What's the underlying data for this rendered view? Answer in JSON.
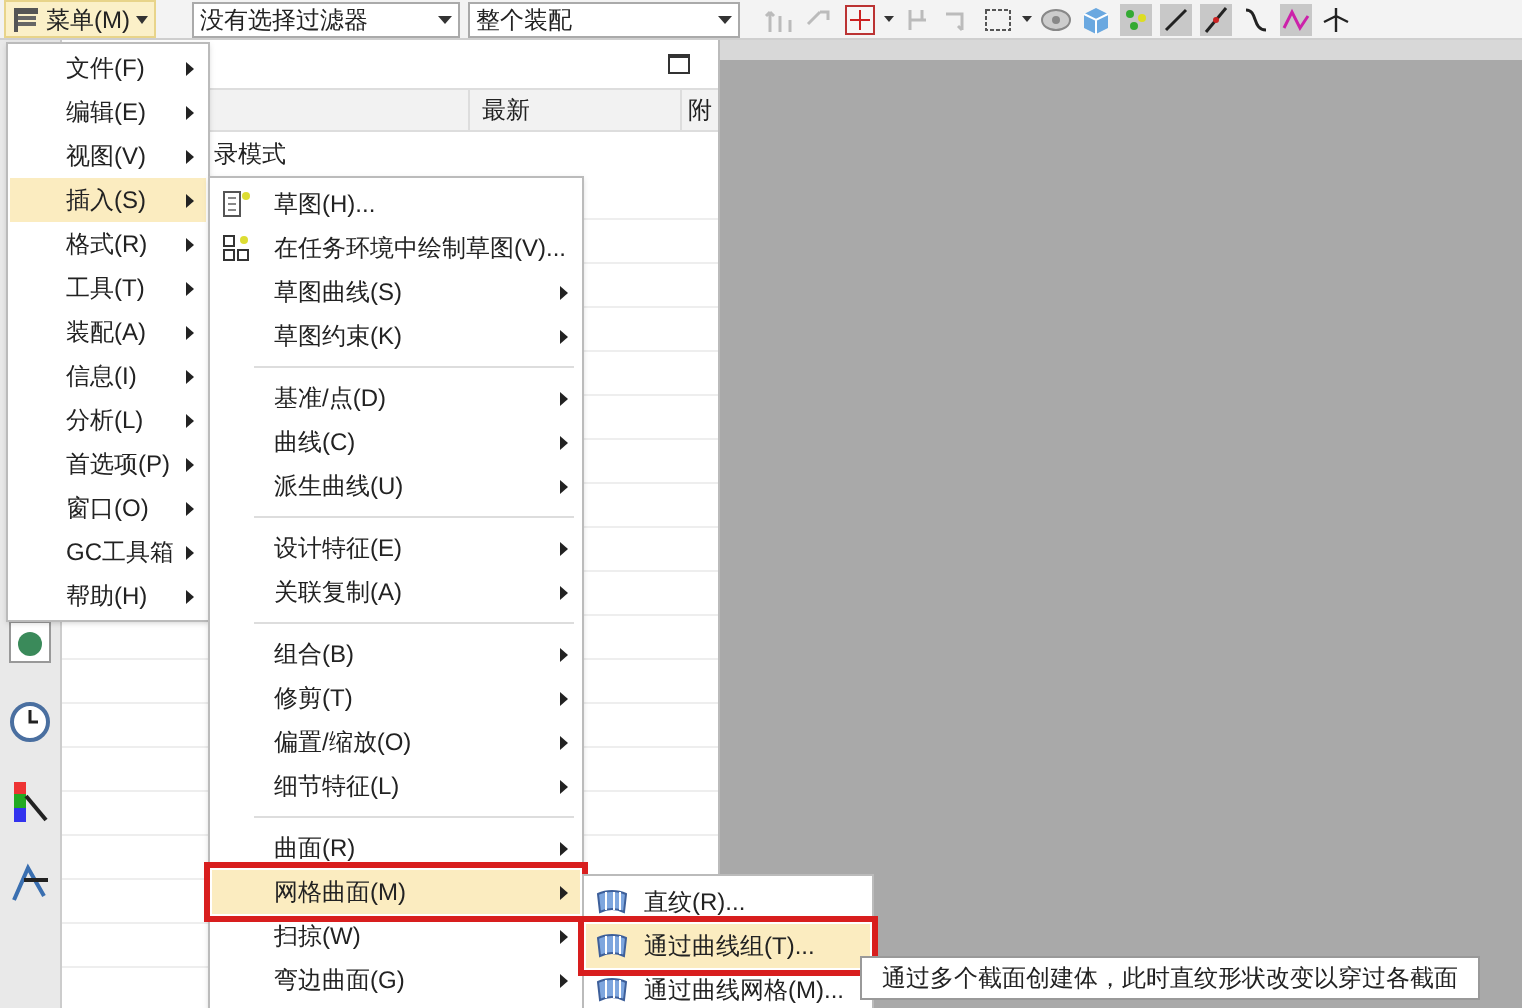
{
  "toolbar": {
    "menu_button": "菜单(M)",
    "filter_select": "没有选择过滤器",
    "assembly_select": "整个装配"
  },
  "panel": {
    "columns": [
      "最新",
      "附"
    ],
    "row_text": "录模式"
  },
  "main_menu": [
    {
      "label": "文件(F)",
      "selected": false
    },
    {
      "label": "编辑(E)",
      "selected": false
    },
    {
      "label": "视图(V)",
      "selected": false
    },
    {
      "label": "插入(S)",
      "selected": true
    },
    {
      "label": "格式(R)",
      "selected": false
    },
    {
      "label": "工具(T)",
      "selected": false
    },
    {
      "label": "装配(A)",
      "selected": false
    },
    {
      "label": "信息(I)",
      "selected": false
    },
    {
      "label": "分析(L)",
      "selected": false
    },
    {
      "label": "首选项(P)",
      "selected": false
    },
    {
      "label": "窗口(O)",
      "selected": false
    },
    {
      "label": "GC工具箱",
      "selected": false
    },
    {
      "label": "帮助(H)",
      "selected": false
    }
  ],
  "insert_menu": [
    {
      "kind": "command",
      "label": "草图(H)...",
      "selected": false,
      "framed": false
    },
    {
      "kind": "command",
      "label": "在任务环境中绘制草图(V)...",
      "selected": false,
      "framed": false
    },
    {
      "kind": "submenu",
      "label": "草图曲线(S)",
      "selected": false,
      "framed": false
    },
    {
      "kind": "submenu",
      "label": "草图约束(K)",
      "selected": false,
      "framed": false
    },
    {
      "kind": "separator"
    },
    {
      "kind": "submenu",
      "label": "基准/点(D)",
      "selected": false,
      "framed": false
    },
    {
      "kind": "submenu",
      "label": "曲线(C)",
      "selected": false,
      "framed": false
    },
    {
      "kind": "submenu",
      "label": "派生曲线(U)",
      "selected": false,
      "framed": false
    },
    {
      "kind": "separator"
    },
    {
      "kind": "submenu",
      "label": "设计特征(E)",
      "selected": false,
      "framed": false
    },
    {
      "kind": "submenu",
      "label": "关联复制(A)",
      "selected": false,
      "framed": false
    },
    {
      "kind": "separator"
    },
    {
      "kind": "submenu",
      "label": "组合(B)",
      "selected": false,
      "framed": false
    },
    {
      "kind": "submenu",
      "label": "修剪(T)",
      "selected": false,
      "framed": false
    },
    {
      "kind": "submenu",
      "label": "偏置/缩放(O)",
      "selected": false,
      "framed": false
    },
    {
      "kind": "submenu",
      "label": "细节特征(L)",
      "selected": false,
      "framed": false
    },
    {
      "kind": "separator"
    },
    {
      "kind": "submenu",
      "label": "曲面(R)",
      "selected": false,
      "framed": false
    },
    {
      "kind": "submenu",
      "label": "网格曲面(M)",
      "selected": true,
      "framed": true
    },
    {
      "kind": "submenu",
      "label": "扫掠(W)",
      "selected": false,
      "framed": false
    },
    {
      "kind": "submenu",
      "label": "弯边曲面(G)",
      "selected": false,
      "framed": false
    }
  ],
  "mesh_menu": [
    {
      "label": "直纹(R)...",
      "selected": false,
      "framed": false
    },
    {
      "label": "通过曲线组(T)...",
      "selected": true,
      "framed": true
    },
    {
      "label": "通过曲线网格(M)...",
      "selected": false,
      "framed": false
    }
  ],
  "tooltip": "通过多个截面创建体，此时直纹形状改变以穿过各截面"
}
